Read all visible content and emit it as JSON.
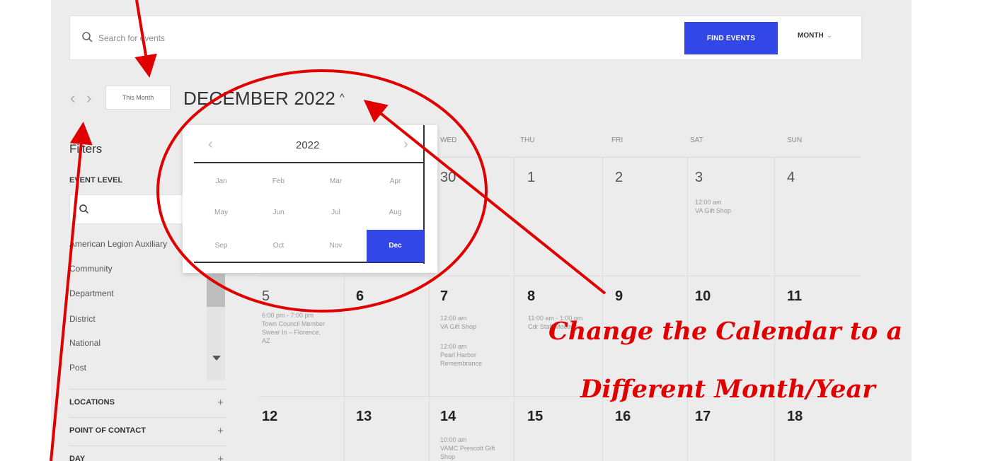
{
  "search": {
    "placeholder": "Search for events"
  },
  "toolbar": {
    "find_label": "FIND EVENTS",
    "view_label": "MONTH",
    "view_chevron": "⌄"
  },
  "nav": {
    "prev": "‹",
    "next": "›",
    "this_month_label": "This Month",
    "month_title": "DECEMBER 2022",
    "title_caret": "^"
  },
  "filters": {
    "title": "Filters",
    "event_level_label": "EVENT LEVEL",
    "items": [
      "American Legion Auxiliary",
      "Community",
      "Department",
      "District",
      "National",
      "Post"
    ],
    "accordions": [
      {
        "label": "LOCATIONS",
        "icon": "+"
      },
      {
        "label": "POINT OF CONTACT",
        "icon": "+"
      },
      {
        "label": "DAY",
        "icon": "+"
      }
    ]
  },
  "calendar": {
    "weekdays": [
      "WED",
      "THU",
      "FRI",
      "SAT",
      "SUN"
    ],
    "week1": [
      "30",
      "1",
      "2",
      "3",
      "4"
    ],
    "week2": [
      "5",
      "6",
      "7",
      "8",
      "9",
      "10",
      "11"
    ],
    "week3": [
      "12",
      "13",
      "14",
      "15",
      "16",
      "17",
      "18"
    ],
    "events": {
      "dec3": {
        "time": "12:00 am",
        "title": "VA Gift Shop"
      },
      "dec5": {
        "time": "6:00 pm - 7:00 pm",
        "title": "Town Council Member Swear In – Florence, AZ"
      },
      "dec7a": {
        "time": "12:00 am",
        "title": "VA Gift Shop"
      },
      "dec7b": {
        "time": "12:00 am",
        "title": "Pearl Harbor Remembrance"
      },
      "dec8": {
        "time": "11:00 am - 1:00 pm",
        "title": "Cdr Staff Meeting."
      },
      "dec14": {
        "time": "10:00 am",
        "title": "VAMC Prescott Gift Shop"
      }
    }
  },
  "month_picker": {
    "prev": "‹",
    "next": "›",
    "year": "2022",
    "months": [
      "Jan",
      "Feb",
      "Mar",
      "Apr",
      "May",
      "Jun",
      "Jul",
      "Aug",
      "Sep",
      "Oct",
      "Nov",
      "Dec"
    ],
    "selected": "Dec"
  },
  "annotation": {
    "line1": "Change the Calendar to a",
    "line2": "Different Month/Year",
    "color": "#e00000"
  }
}
